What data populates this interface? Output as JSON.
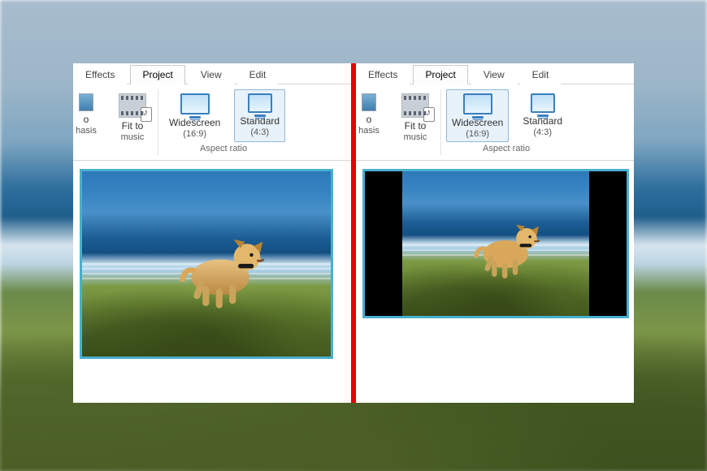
{
  "tabs": {
    "effects": "Effects",
    "project": "Project",
    "view": "View",
    "edit": "Edit",
    "active": "Project"
  },
  "ribbon": {
    "cut_item": {
      "line1": "o",
      "line2": "hasis"
    },
    "fit_to_music": {
      "line1": "Fit to",
      "line2": "music"
    },
    "widescreen": {
      "label": "Widescreen",
      "ratio": "(16:9)"
    },
    "standard": {
      "label": "Standard",
      "ratio": "(4:3)"
    },
    "group_label_aspect": "Aspect ratio"
  },
  "panel_left": {
    "selected_aspect": "standard"
  },
  "panel_right": {
    "selected_aspect": "widescreen"
  }
}
